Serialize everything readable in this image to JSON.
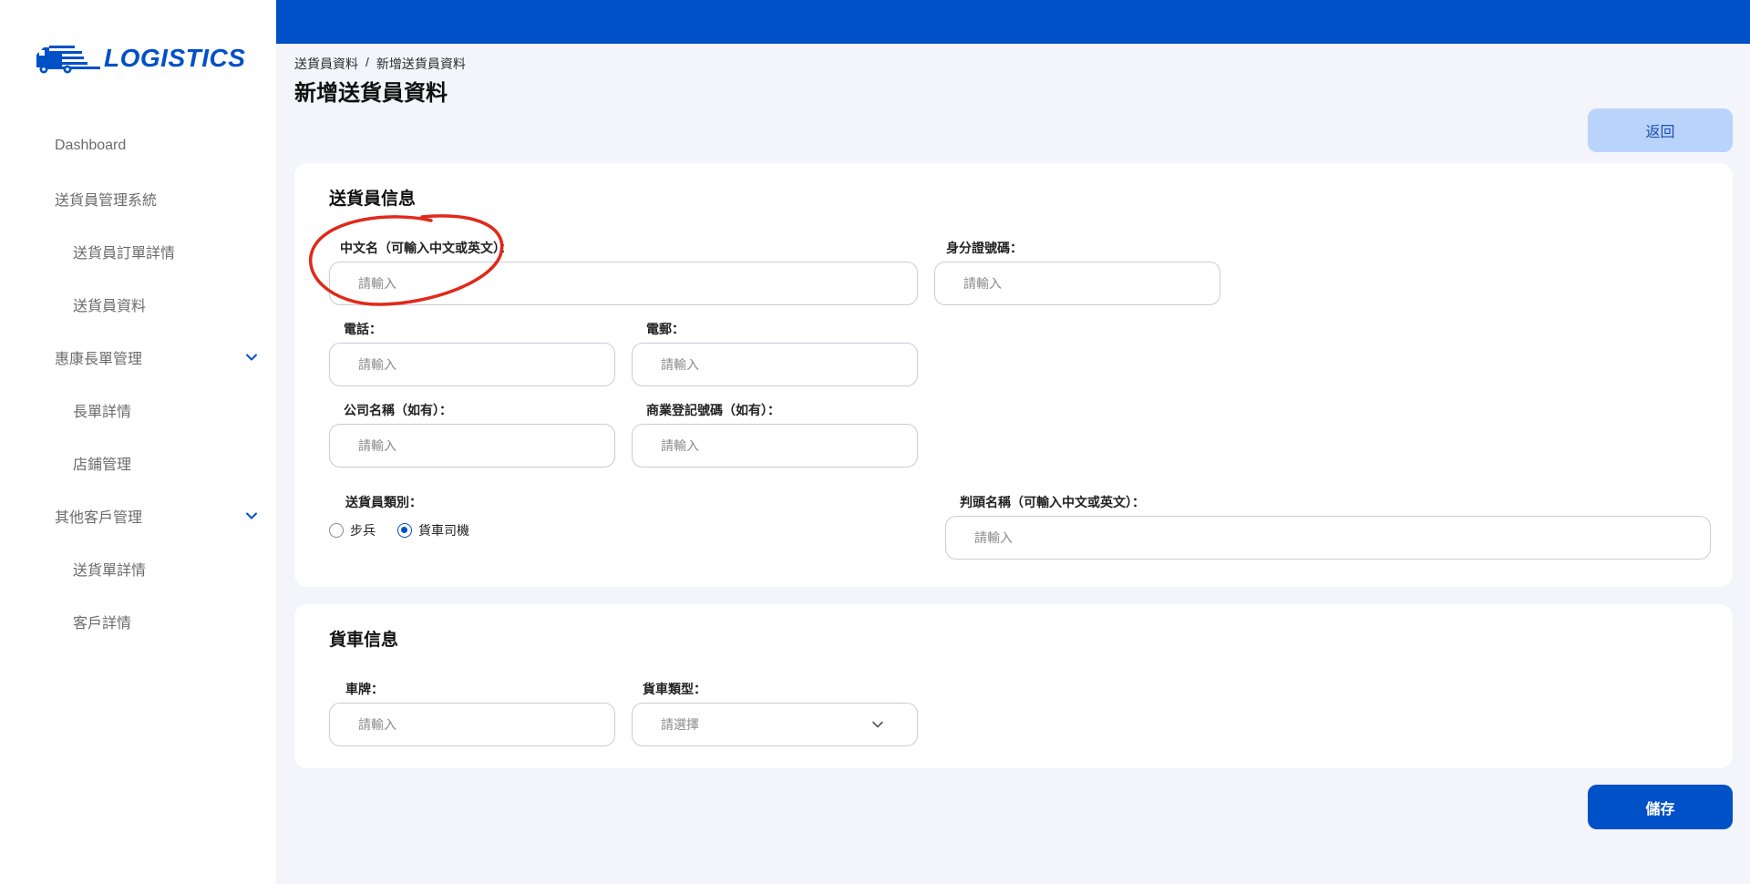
{
  "brand": {
    "name": "LOGISTICS",
    "color": "#0050c8"
  },
  "sidebar": {
    "items": [
      {
        "label": "Dashboard",
        "sub": false
      },
      {
        "label": "送貨員管理系統",
        "sub": false
      },
      {
        "label": "送貨員訂單詳情",
        "sub": true
      },
      {
        "label": "送貨員資料",
        "sub": true
      },
      {
        "label": "惠康長單管理",
        "sub": false,
        "expandable": true
      },
      {
        "label": "長單詳情",
        "sub": true
      },
      {
        "label": "店鋪管理",
        "sub": true
      },
      {
        "label": "其他客戶管理",
        "sub": false,
        "expandable": true
      },
      {
        "label": "送貨單詳情",
        "sub": true
      },
      {
        "label": "客戶詳情",
        "sub": true
      }
    ]
  },
  "breadcrumb": {
    "parent": "送貨員資料",
    "separator": "/",
    "current": "新增送貨員資料"
  },
  "page": {
    "title": "新增送貨員資料"
  },
  "actions": {
    "back_label": "返回",
    "save_label": "儲存"
  },
  "courier_section": {
    "title": "送貨員信息",
    "chinese_name": {
      "label": "中文名（可輸入中文或英文）：",
      "placeholder": "請輸入"
    },
    "id_number": {
      "label": "身分證號碼：",
      "placeholder": "請輸入"
    },
    "phone": {
      "label": "電話：",
      "placeholder": "請輸入"
    },
    "email": {
      "label": "電郵：",
      "placeholder": "請輸入"
    },
    "company": {
      "label": "公司名稱（如有）：",
      "placeholder": "請輸入"
    },
    "br_number": {
      "label": "商業登記號碼（如有）：",
      "placeholder": "請輸入"
    },
    "type": {
      "label": "送貨員類別：",
      "options": [
        "步兵",
        "貨車司機"
      ],
      "selected": "貨車司機"
    },
    "title_name": {
      "label": "判頭名稱（可輸入中文或英文）：",
      "placeholder": "請輸入"
    }
  },
  "truck_section": {
    "title": "貨車信息",
    "plate": {
      "label": "車牌：",
      "placeholder": "請輸入"
    },
    "truck_type": {
      "label": "貨車類型：",
      "placeholder": "請選擇"
    }
  },
  "colors": {
    "primary": "#0050c8",
    "back_button_bg": "#b9d3fb",
    "annotation": "#e0291b"
  }
}
